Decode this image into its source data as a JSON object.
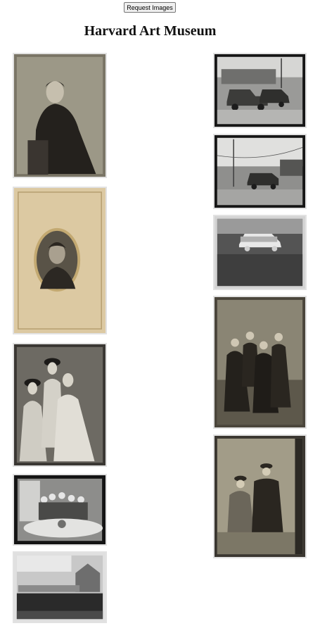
{
  "toolbar": {
    "request_label": "Request Images"
  },
  "header": {
    "title": "Harvard Art Museum"
  },
  "gallery": {
    "left": [
      {
        "kind": "tintype-woman-seated"
      },
      {
        "kind": "cabinet-card-portrait"
      },
      {
        "kind": "tintype-three-women"
      },
      {
        "kind": "photo-family-table"
      },
      {
        "kind": "negative-house-group"
      }
    ],
    "right": [
      {
        "kind": "photo-trucks-street"
      },
      {
        "kind": "photo-street-car"
      },
      {
        "kind": "negative-car-lot"
      },
      {
        "kind": "tintype-four-women"
      },
      {
        "kind": "tintype-two-women"
      }
    ]
  }
}
